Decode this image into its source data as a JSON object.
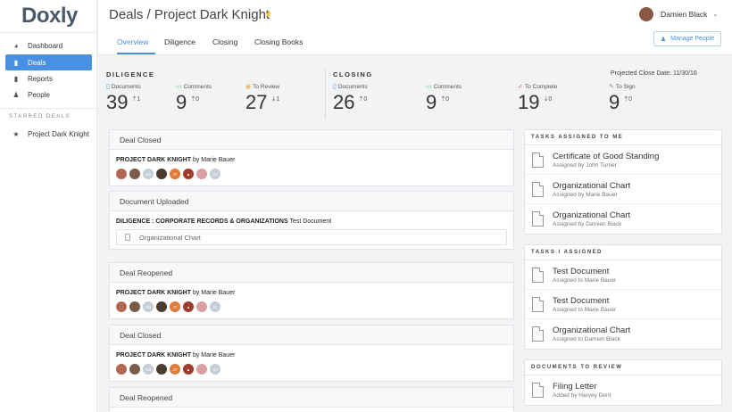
{
  "app": {
    "logo": "Doxly"
  },
  "sidebar": {
    "items": [
      {
        "label": "Dashboard",
        "icon": "dashboard-icon",
        "glyph": "◕"
      },
      {
        "label": "Deals",
        "icon": "document-icon",
        "glyph": "▮"
      },
      {
        "label": "Reports",
        "icon": "bar-chart-icon",
        "glyph": "▮"
      },
      {
        "label": "People",
        "icon": "people-icon",
        "glyph": "♟"
      }
    ],
    "starred_label": "STARRED DEALS",
    "starred_items": [
      {
        "label": "Project Dark Knight",
        "glyph": "★"
      }
    ]
  },
  "header": {
    "title": "Deals / Project Dark Knight",
    "tabs": [
      "Overview",
      "Diligence",
      "Closing",
      "Closing Books"
    ],
    "user_name": "Damien Black",
    "manage_label": "Manage People"
  },
  "stats": {
    "diligence_title": "DILIGENCE",
    "closing_title": "CLOSING",
    "projected": "Projected Close Date: 11/30/16",
    "diligence": [
      {
        "label": "Documents",
        "value": "39",
        "delta": "⇡1",
        "glyph": "▯",
        "color": "#4a90e2"
      },
      {
        "label": "Comments",
        "value": "9",
        "delta": "⇡0",
        "glyph": "▭",
        "color": "#5cb85c"
      },
      {
        "label": "To Review",
        "value": "27",
        "delta": "⇣1",
        "glyph": "◉",
        "color": "#f0ad4e"
      }
    ],
    "closing": [
      {
        "label": "Documents",
        "value": "26",
        "delta": "⇡0",
        "glyph": "▯",
        "color": "#4a90e2"
      },
      {
        "label": "Comments",
        "value": "9",
        "delta": "⇡0",
        "glyph": "▭",
        "color": "#5cb85c"
      },
      {
        "label": "To Complete",
        "value": "19",
        "delta": "⇣0",
        "glyph": "✓",
        "color": "#d9534f"
      },
      {
        "label": "To Sign",
        "value": "9",
        "delta": "⇡0",
        "glyph": "✎",
        "color": "#888888"
      }
    ]
  },
  "feed": [
    {
      "title": "Deal Closed",
      "line_bold": "PROJECT DARK KNIGHT",
      "line_rest": " by Marie Bauer",
      "avatars": true
    },
    {
      "title": "Document Uploaded",
      "line_bold": "DILIGENCE : CORPORATE RECORDS & ORGANIZATIONS",
      "line_rest": " Test Document",
      "doc": "Organizational Chart"
    },
    {
      "title": "Deal Reopened",
      "line_bold": "PROJECT DARK KNIGHT",
      "line_rest": " by Marie Bauer",
      "avatars": true
    },
    {
      "title": "Deal Closed",
      "line_bold": "PROJECT DARK KNIGHT",
      "line_rest": " by Marie Bauer",
      "avatars": true
    },
    {
      "title": "Deal Reopened"
    }
  ],
  "avatar_row": [
    {
      "color": "#b06a50",
      "text": ""
    },
    {
      "color": "#7b5b4a",
      "text": ""
    },
    {
      "color": "#c5ced6",
      "text": "DB"
    },
    {
      "color": "#4b3a2e",
      "text": ""
    },
    {
      "color": "#e07b39",
      "text": "JT"
    },
    {
      "color": "#a03a2a",
      "text": "▲"
    },
    {
      "color": "#d8a0a0",
      "text": ""
    },
    {
      "color": "#c5ced6",
      "text": "JC"
    }
  ],
  "panels": {
    "assigned_to_me": {
      "title": "TASKS ASSIGNED TO ME",
      "tasks": [
        {
          "title": "Certificate of Good Standing",
          "sub": "Assigned by John Turner"
        },
        {
          "title": "Organizational Chart",
          "sub": "Assigned by Marie Bauer"
        },
        {
          "title": "Organizational Chart",
          "sub": "Assigned by Damien Black"
        }
      ]
    },
    "i_assigned": {
      "title": "TASKS I ASSIGNED",
      "tasks": [
        {
          "title": "Test Document",
          "sub": "Assigned to Marie Bauer"
        },
        {
          "title": "Test Document",
          "sub": "Assigned to Marie Bauer"
        },
        {
          "title": "Organizational Chart",
          "sub": "Assigned to Damien Black"
        }
      ]
    },
    "to_review": {
      "title": "DOCUMENTS TO REVIEW",
      "tasks": [
        {
          "title": "Filing Letter",
          "sub": "Added by Harvey Dent"
        }
      ]
    }
  }
}
